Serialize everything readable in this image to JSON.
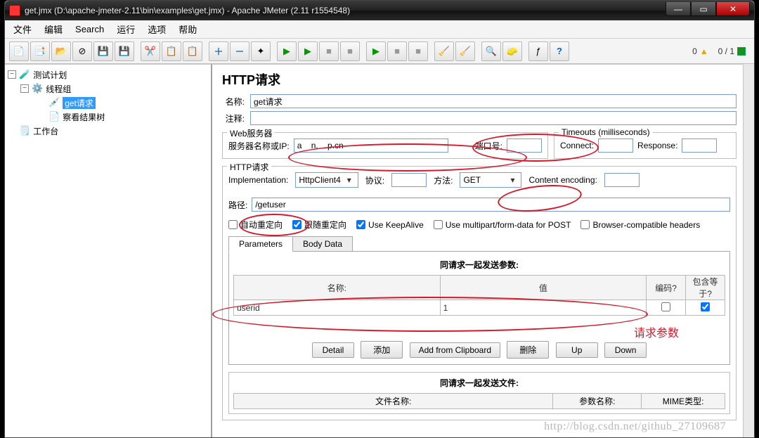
{
  "titlebar": {
    "title": "get.jmx (D:\\apache-jmeter-2.11\\bin\\examples\\get.jmx) - Apache JMeter (2.11 r1554548)"
  },
  "menu": {
    "file": "文件",
    "edit": "编辑",
    "search": "Search",
    "run": "运行",
    "options": "选项",
    "help": "帮助"
  },
  "status": {
    "left": "0",
    "right": "0 / 1"
  },
  "tree": {
    "root": "测试计划",
    "g0": "线程组",
    "sel": "get请求",
    "v0": "察看结果树",
    "wb": "工作台"
  },
  "form": {
    "h1": "HTTP请求",
    "name_lbl": "名称:",
    "name_val": "get请求",
    "comment_lbl": "注释:",
    "comment_ph": ""
  },
  "web": {
    "legend": "Web服务器",
    "server_lbl": "服务器名称或IP:",
    "server_val": "a    n.    p.cn",
    "port_lbl": "端口号:",
    "port_val": ""
  },
  "timeout": {
    "legend": "Timeouts (milliseconds)",
    "connect_lbl": "Connect:",
    "resp_lbl": "Response:"
  },
  "http": {
    "legend": "HTTP请求",
    "impl_lbl": "Implementation:",
    "impl_val": "HttpClient4",
    "proto_lbl": "协议:",
    "proto_val": "",
    "method_lbl": "方法:",
    "method_val": "GET",
    "enc_lbl": "Content encoding:",
    "enc_val": "",
    "path_lbl": "路径:",
    "path_val": "/getuser",
    "auto": "自动重定向",
    "follow": "跟随重定向",
    "keep": "Use KeepAlive",
    "multipart": "Use multipart/form-data for POST",
    "compat": "Browser-compatible headers"
  },
  "tabs": {
    "params": "Parameters",
    "body": "Body Data"
  },
  "params": {
    "title": "同请求一起发送参数:",
    "col_name": "名称:",
    "col_value": "值",
    "col_enc": "编码?",
    "col_inc": "包含等于?",
    "row0_name": "userid",
    "row0_value": "1"
  },
  "btns": {
    "detail": "Detail",
    "add": "添加",
    "clip": "Add from Clipboard",
    "del": "删除",
    "up": "Up",
    "down": "Down"
  },
  "files": {
    "title": "同请求一起发送文件:",
    "col_name": "文件名称:",
    "col_param": "参数名称:",
    "col_mime": "MIME类型:"
  },
  "annot": {
    "req_params": "请求参数"
  },
  "watermark": "http://blog.csdn.net/github_27109687"
}
